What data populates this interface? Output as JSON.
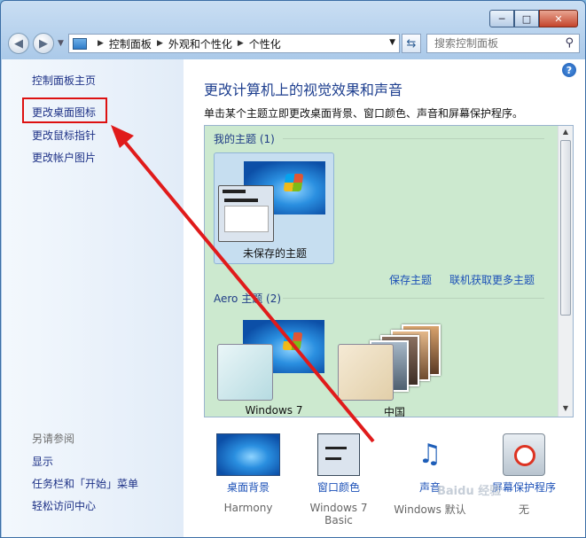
{
  "window": {
    "minimize": "─",
    "maximize": "□",
    "close": "✕"
  },
  "address": {
    "crumbs": [
      "控制面板",
      "外观和个性化",
      "个性化"
    ],
    "search_placeholder": "搜索控制面板"
  },
  "sidebar": {
    "home": "控制面板主页",
    "links": [
      "更改桌面图标",
      "更改鼠标指针",
      "更改帐户图片"
    ],
    "see_also": "另请参阅",
    "also_links": [
      "显示",
      "任务栏和「开始」菜单",
      "轻松访问中心"
    ]
  },
  "main": {
    "title": "更改计算机上的视觉效果和声音",
    "description": "单击某个主题立即更改桌面背景、窗口颜色、声音和屏幕保护程序。",
    "my_themes_label": "我的主题 (1)",
    "unsaved_theme": "未保存的主题",
    "save_theme": "保存主题",
    "get_more": "联机获取更多主题",
    "aero_label": "Aero 主题 (2)",
    "aero_themes": [
      "Windows 7",
      "中国"
    ],
    "bottom": [
      {
        "label": "桌面背景",
        "sub": "Harmony",
        "icon": "desktop-background-icon"
      },
      {
        "label": "窗口颜色",
        "sub": "Windows 7 Basic",
        "icon": "window-color-icon"
      },
      {
        "label": "声音",
        "sub": "Windows 默认",
        "icon": "sound-icon"
      },
      {
        "label": "屏幕保护程序",
        "sub": "无",
        "icon": "screensaver-icon"
      }
    ]
  },
  "watermark": "Baidu 经验",
  "colors": {
    "highlight": "#dd1111",
    "link": "#1b50b7",
    "panel": "#cce9cf"
  }
}
